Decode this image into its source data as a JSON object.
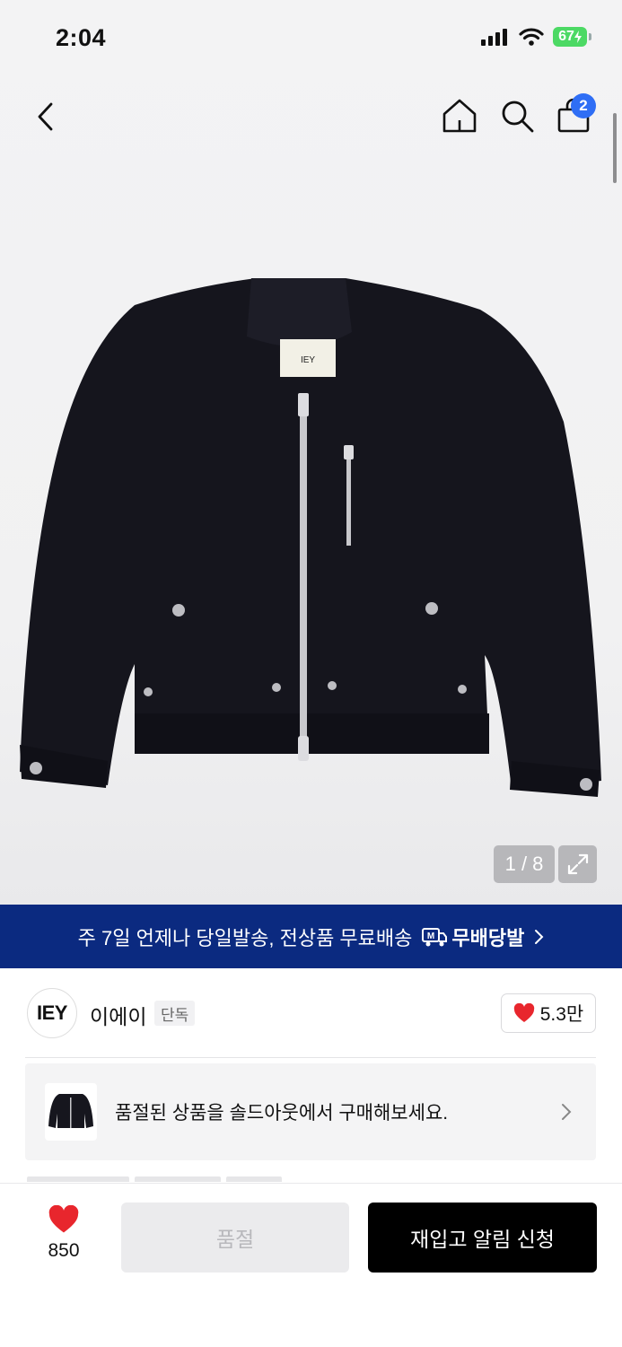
{
  "status_bar": {
    "time": "2:04",
    "battery": "67"
  },
  "nav": {
    "cart_count": "2",
    "icons": [
      "chevron-left-icon",
      "home-icon",
      "search-icon",
      "shopping-bag-icon"
    ]
  },
  "gallery": {
    "counter": "1 / 8",
    "label_on_product": "IEY"
  },
  "promo": {
    "text": "주 7일 언제나 당일발송, 전상품 무료배송",
    "brand": "무배당발",
    "background": "#0b2a80"
  },
  "brand": {
    "logo_text": "IEY",
    "name": "이에이",
    "tag": "단독",
    "likes": "5.3만"
  },
  "soldout_banner": {
    "text": "품절된 상품을 솔드아웃에서 구매해보세요."
  },
  "bottom_bar": {
    "wish_count": "850",
    "soldout_label": "품절",
    "restock_label": "재입고 알림 신청"
  },
  "colors": {
    "accent_blue": "#2f6ef5",
    "heart_red": "#e8262d",
    "primary_button": "#000000"
  }
}
